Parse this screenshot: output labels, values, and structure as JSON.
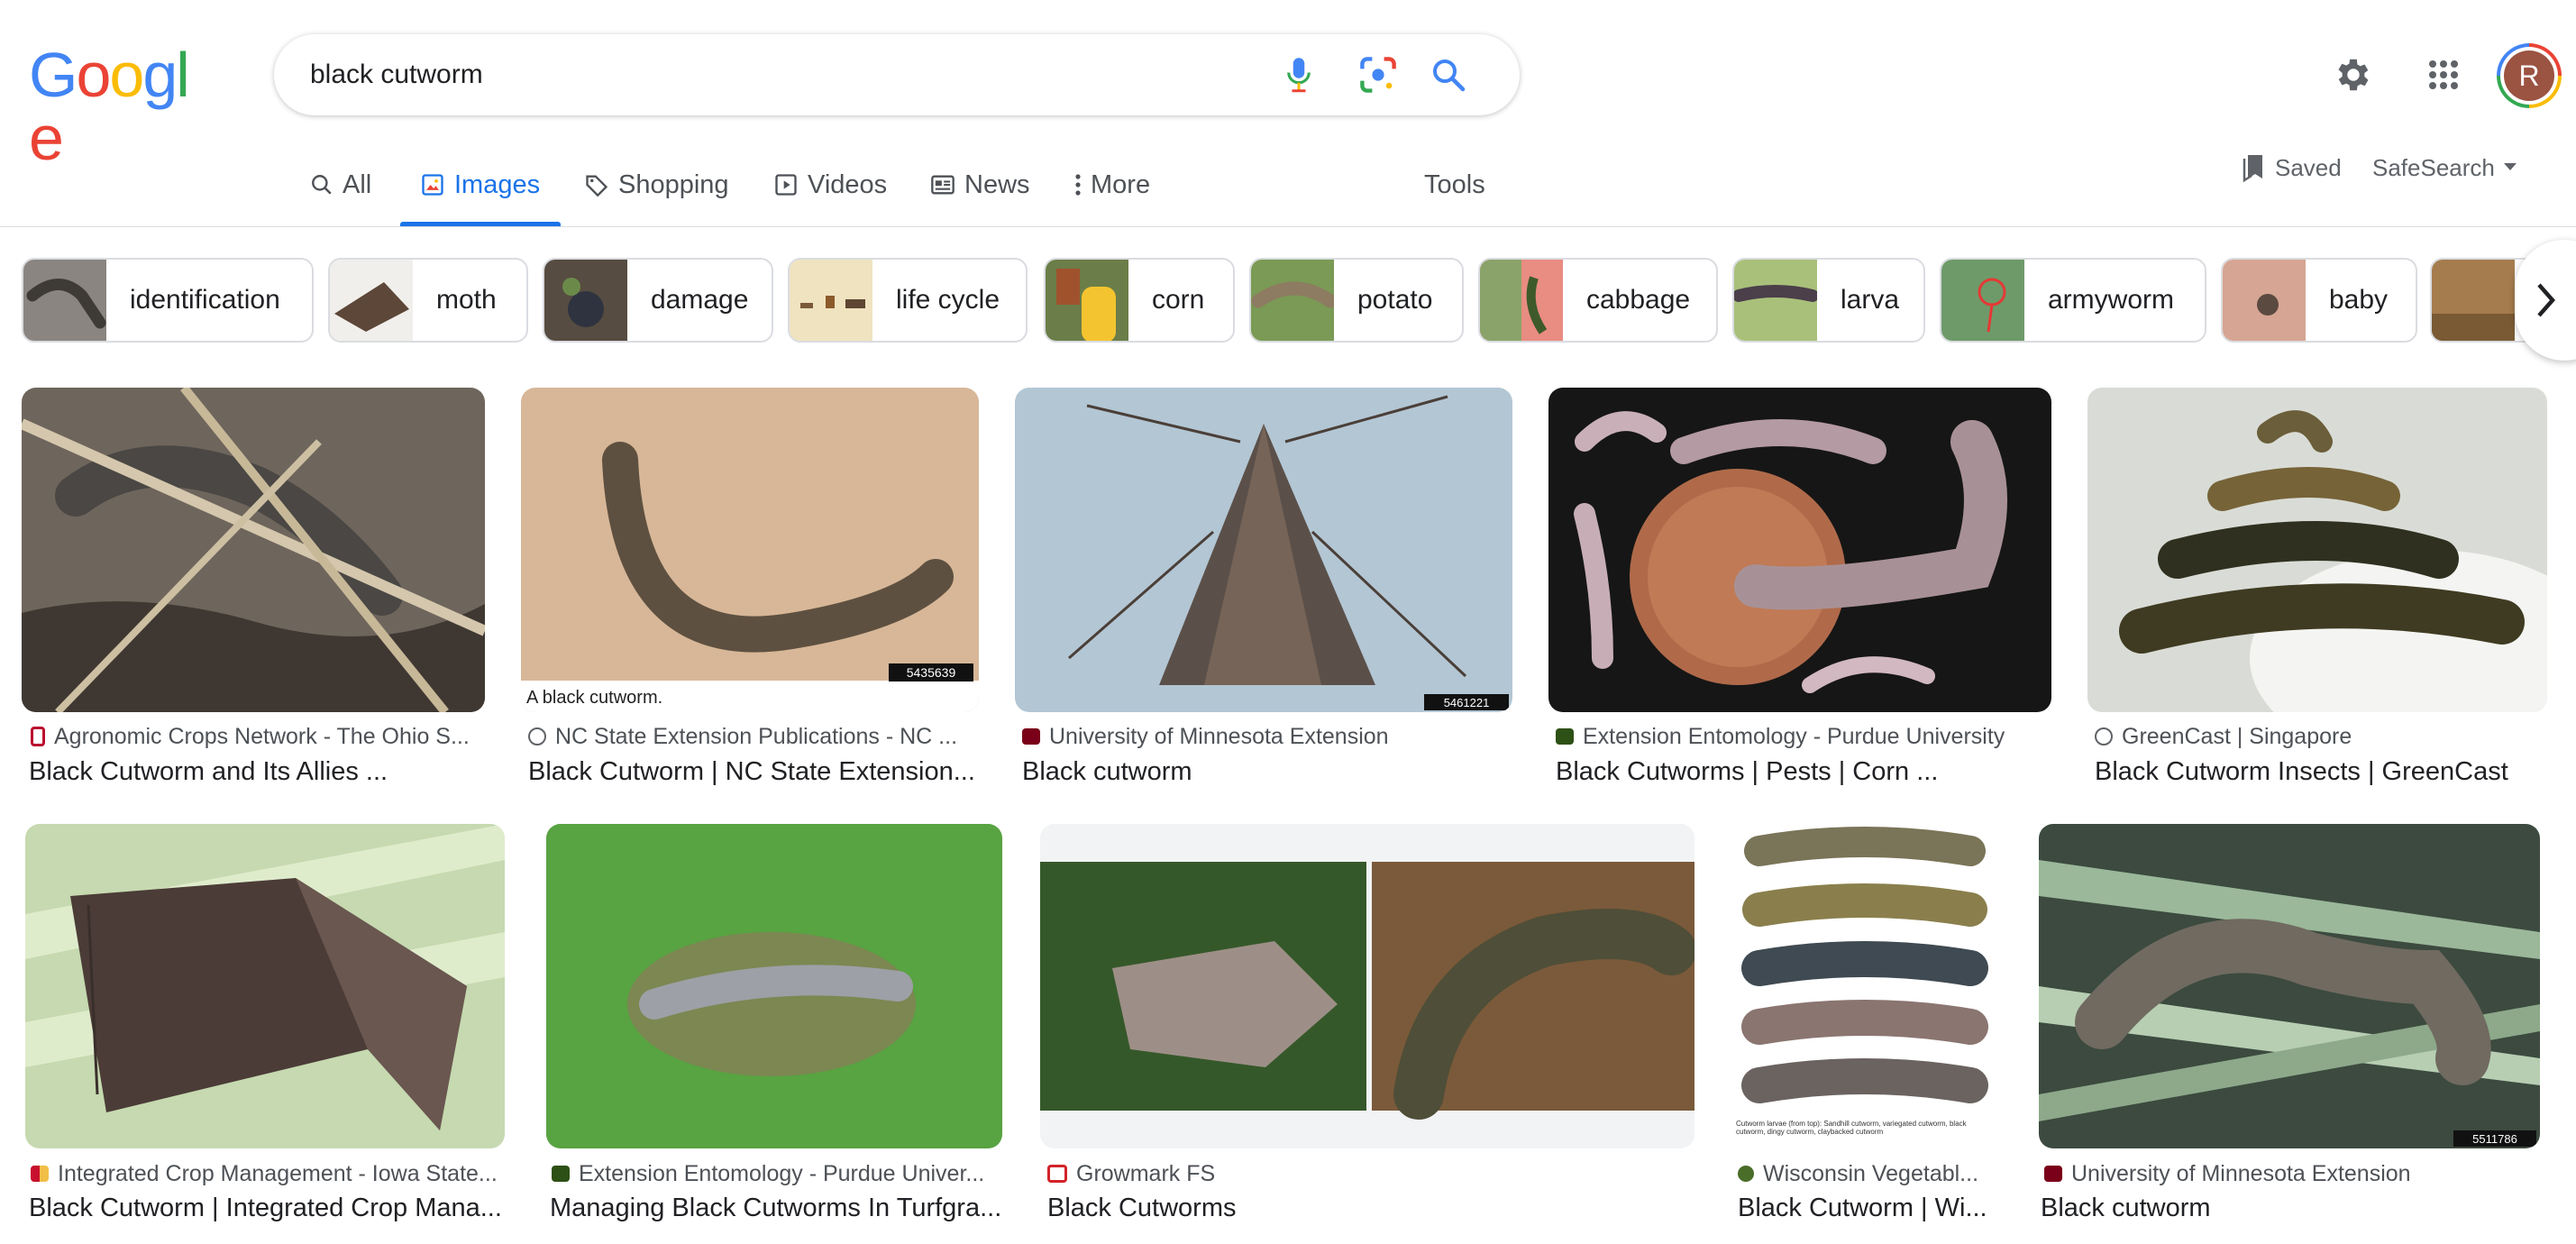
{
  "header": {
    "logo_text": "Google",
    "search_query": "black cutworm",
    "icons": [
      "microphone-icon",
      "lens-icon",
      "search-icon",
      "settings-icon",
      "apps-icon"
    ],
    "avatar_initial": "R"
  },
  "tabs": [
    {
      "label": "All",
      "icon": "search-icon"
    },
    {
      "label": "Images",
      "icon": "image-icon",
      "active": true
    },
    {
      "label": "Shopping",
      "icon": "tag-icon"
    },
    {
      "label": "Videos",
      "icon": "play-icon"
    },
    {
      "label": "News",
      "icon": "news-icon"
    },
    {
      "label": "More",
      "icon": "dots-icon"
    }
  ],
  "tools_label": "Tools",
  "saved_label": "Saved",
  "safesearch_label": "SafeSearch",
  "chips": [
    {
      "label": "identification"
    },
    {
      "label": "moth"
    },
    {
      "label": "damage"
    },
    {
      "label": "life cycle"
    },
    {
      "label": "corn"
    },
    {
      "label": "potato"
    },
    {
      "label": "cabbage"
    },
    {
      "label": "larva"
    },
    {
      "label": "armyworm"
    },
    {
      "label": "baby"
    }
  ],
  "results_row1": [
    {
      "source": "Agronomic Crops Network - The Ohio S...",
      "title": "Black Cutworm and Its Allies ..."
    },
    {
      "source": "NC State Extension Publications - NC ...",
      "title": "Black Cutworm | NC State Extension...",
      "caption": "A black cutworm.",
      "id_tag": "5435639"
    },
    {
      "source": "University of Minnesota Extension",
      "title": "Black cutworm",
      "id_tag": "5461221"
    },
    {
      "source": "Extension Entomology - Purdue University",
      "title": "Black Cutworms | Pests | Corn ..."
    },
    {
      "source": "GreenCast | Singapore",
      "title": "Black Cutworm Insects | GreenCast"
    }
  ],
  "results_row2": [
    {
      "source": "Integrated Crop Management - Iowa State...",
      "title": "Black Cutworm | Integrated Crop Mana..."
    },
    {
      "source": "Extension Entomology - Purdue Univer...",
      "title": "Managing Black Cutworms In Turfgra..."
    },
    {
      "source": "Growmark FS",
      "title": "Black Cutworms"
    },
    {
      "source": "Wisconsin Vegetabl...",
      "title": "Black Cutworm | Wi...",
      "caption": "Cutworm larvae (from top): Sandhill cutworm, variegated cutworm, black cutworm, dingy cutworm, claybacked cutworm"
    },
    {
      "source": "University of Minnesota Extension",
      "title": "Black cutworm",
      "id_tag": "5511786"
    }
  ],
  "colors": {
    "accent": "#1a73e8",
    "google_blue": "#4285f4",
    "google_red": "#ea4335",
    "google_yellow": "#fbbc05",
    "google_green": "#34a853"
  }
}
